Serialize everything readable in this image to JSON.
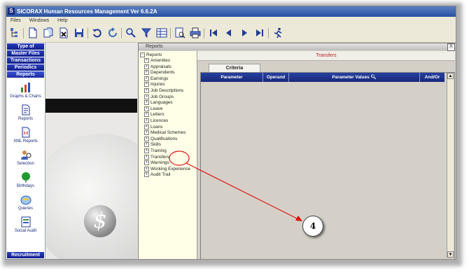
{
  "window": {
    "title": "SICORAX Human Resources Management Ver 6.6.2A",
    "app_icon": "S"
  },
  "menu": [
    "Files",
    "Windows",
    "Help"
  ],
  "toolbar_icons": [
    "tree-icon",
    "new-document-icon",
    "copy-document-icon",
    "delete-icon",
    "save-icon",
    "undo-icon",
    "refresh-icon",
    "zoom-icon",
    "filter-icon",
    "grid-icon",
    "preview-icon",
    "print-icon",
    "first-record-icon",
    "previous-record-icon",
    "next-record-icon",
    "last-record-icon",
    "run-icon"
  ],
  "sidebar": {
    "nav": [
      "Type of",
      "Master Files",
      "Transactions",
      "Periodics",
      "Reports"
    ],
    "items": [
      {
        "label": "Graphs & Charts",
        "icon": "graphs-charts-icon"
      },
      {
        "label": "Reports",
        "icon": "reports-icon"
      },
      {
        "label": "XML Reports",
        "icon": "xml-reports-icon"
      },
      {
        "label": "Selection",
        "icon": "selection-icon"
      },
      {
        "label": "Birthdays",
        "icon": "birthdays-icon"
      },
      {
        "label": "Queries",
        "icon": "queries-icon"
      },
      {
        "label": "Social Audit",
        "icon": "social-audit-icon"
      }
    ],
    "recruitment": "Recruitment"
  },
  "reports_window": {
    "title": "Reports",
    "close": "X",
    "tree_root": "Reports",
    "tree_items": [
      "Amenities",
      "Appraisals",
      "Dependents",
      "Earnings",
      "Injuries",
      "Job Descriptions",
      "Job Groups",
      "Languages",
      "Leave",
      "Letters",
      "Licences",
      "Loans",
      "Medical Schemes",
      "Qualifications",
      "Skills",
      "Training",
      "Transfers",
      "Warnings",
      "Working Experience",
      "Audit Trail"
    ],
    "header": "Transfers",
    "tab": "Criteria",
    "columns": [
      "Parameter",
      "Operand",
      "Parameter Values",
      "And/Or"
    ]
  },
  "callout": {
    "number": "4"
  },
  "colors": {
    "accent": "#1b2f9c",
    "annotation": "#e01010",
    "header_text": "#b21e1e"
  }
}
